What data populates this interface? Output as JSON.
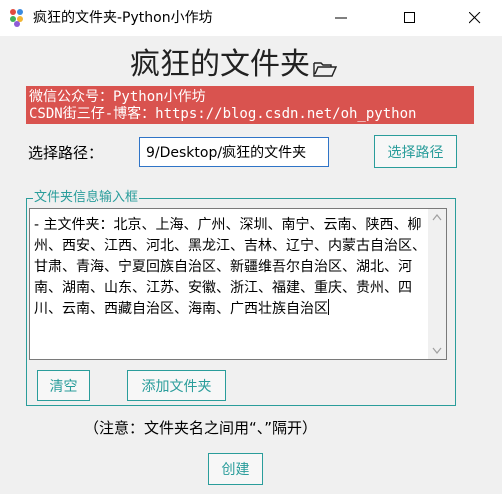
{
  "window": {
    "title": "疯狂的文件夹-Python小作坊",
    "app_icon": "colored-dots-icon",
    "controls": [
      "minimize-icon",
      "maximize-icon",
      "close-icon"
    ]
  },
  "heading": {
    "text": "疯狂的文件夹",
    "icon": "folder-icon"
  },
  "banner": {
    "line1": "微信公众号：Python小作坊",
    "line2": "CSDN街三仔-博客：https://blog.csdn.net/oh_python",
    "background": "#d9534f",
    "text_color": "#ffffff"
  },
  "path": {
    "label": "选择路径：",
    "value": "9/Desktop/疯狂的文件夹",
    "button": "选择路径"
  },
  "input_frame": {
    "legend": "文件夹信息输入框",
    "text": "- 主文件夹：北京、上海、广州、深圳、南宁、云南、陕西、柳州、西安、江西、河北、黑龙江、吉林、辽宁、内蒙古自治区、甘肃、青海、宁夏回族自治区、新疆维吾尔自治区、湖北、河南、湖南、山东、江苏、安徽、浙江、福建、重庆、贵州、四川、云南、西藏自治区、海南、广西壮族自治区",
    "clear_button": "清空",
    "add_button": "添加文件夹"
  },
  "note": "（注意：文件夹名之间用“、”隔开）",
  "create_button": "创建",
  "colors": {
    "accent": "#2a9d9b",
    "input_border": "#2f74c7"
  }
}
